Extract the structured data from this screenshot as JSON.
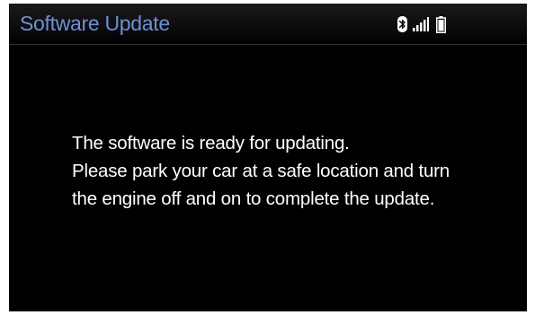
{
  "header": {
    "title": "Software Update",
    "icons": [
      "bluetooth-icon",
      "signal-strength-icon",
      "battery-icon"
    ]
  },
  "message": {
    "lines": [
      "The software is ready for updating.",
      "Please park your car at a safe location and turn",
      "the engine off and on to complete the update."
    ]
  },
  "colors": {
    "title": "#6f8fd8",
    "background": "#000000",
    "text": "#ffffff"
  }
}
